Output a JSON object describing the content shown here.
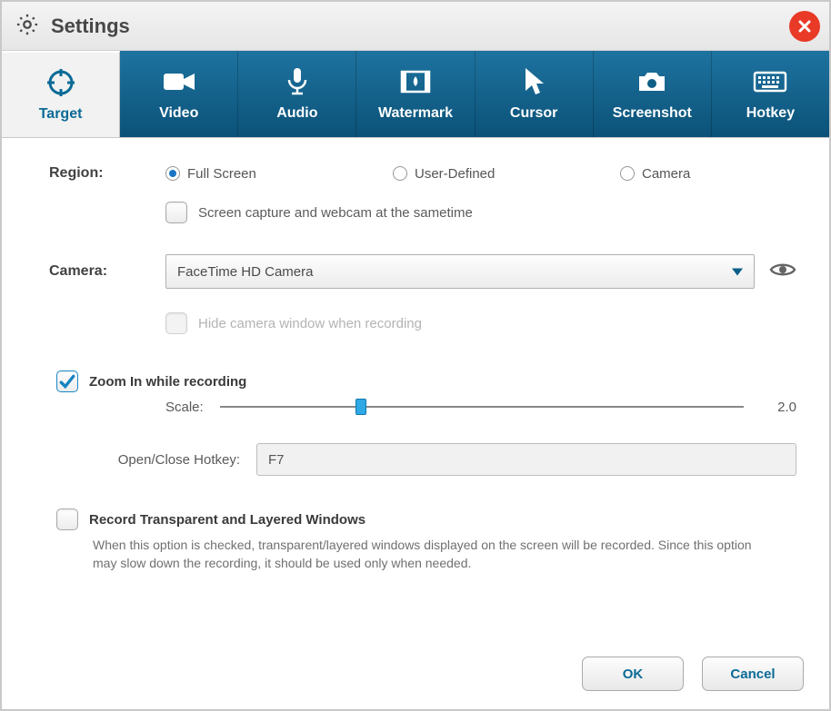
{
  "window": {
    "title": "Settings"
  },
  "tabs": [
    {
      "id": "target",
      "label": "Target"
    },
    {
      "id": "video",
      "label": "Video"
    },
    {
      "id": "audio",
      "label": "Audio"
    },
    {
      "id": "watermark",
      "label": "Watermark"
    },
    {
      "id": "cursor",
      "label": "Cursor"
    },
    {
      "id": "screenshot",
      "label": "Screenshot"
    },
    {
      "id": "hotkey",
      "label": "Hotkey"
    }
  ],
  "region": {
    "label": "Region:",
    "opt_full": "Full Screen",
    "opt_user": "User-Defined",
    "opt_camera": "Camera",
    "selected": "full",
    "dual_label": "Screen capture and webcam at the sametime",
    "dual_checked": false
  },
  "camera": {
    "label": "Camera:",
    "selected": "FaceTime HD Camera",
    "hide_label": "Hide camera window when recording",
    "hide_checked": false,
    "hide_enabled": false
  },
  "zoom": {
    "label": "Zoom In while recording",
    "checked": true,
    "scale_label": "Scale:",
    "scale_value": "2.0"
  },
  "hotkey": {
    "label": "Open/Close Hotkey:",
    "value": "F7"
  },
  "transparent": {
    "label": "Record Transparent and Layered Windows",
    "checked": false,
    "desc": "When this option is checked, transparent/layered windows displayed on the screen will be recorded. Since this option may slow down the recording, it should be used only when needed."
  },
  "footer": {
    "ok": "OK",
    "cancel": "Cancel"
  }
}
